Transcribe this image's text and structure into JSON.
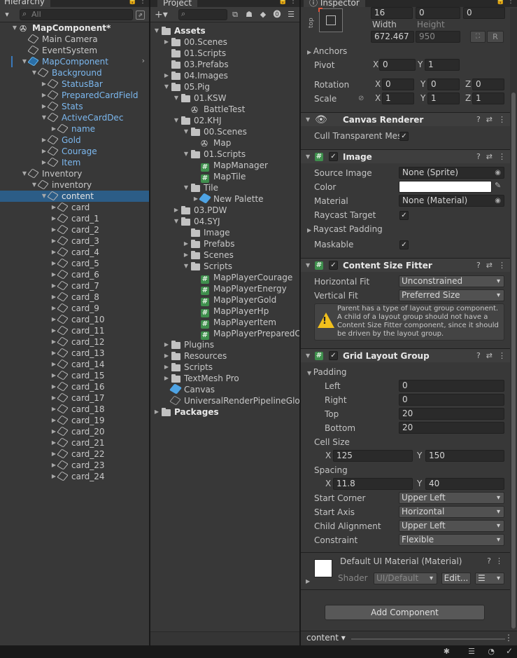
{
  "hierarchy": {
    "tab": "Hierarchy",
    "search_placeholder": "All",
    "rows": [
      {
        "label": "MapComponent*",
        "depth": 0,
        "arrow": "▼",
        "icon": "unity",
        "style": "bold"
      },
      {
        "label": "Main Camera",
        "depth": 1,
        "arrow": "",
        "icon": "go",
        "style": ""
      },
      {
        "label": "EventSystem",
        "depth": 1,
        "arrow": "",
        "icon": "go",
        "style": ""
      },
      {
        "label": "MapComponent",
        "depth": 1,
        "arrow": "▼",
        "icon": "goblue",
        "style": "blue"
      },
      {
        "label": "Background",
        "depth": 2,
        "arrow": "▼",
        "icon": "go",
        "style": "blue"
      },
      {
        "label": "StatusBar",
        "depth": 3,
        "arrow": "▶",
        "icon": "go",
        "style": "blue"
      },
      {
        "label": "PreparedCardField",
        "depth": 3,
        "arrow": "▶",
        "icon": "go",
        "style": "blue"
      },
      {
        "label": "Stats",
        "depth": 3,
        "arrow": "▶",
        "icon": "go",
        "style": "blue"
      },
      {
        "label": "ActiveCardDec",
        "depth": 3,
        "arrow": "▼",
        "icon": "go",
        "style": "blue"
      },
      {
        "label": "name",
        "depth": 4,
        "arrow": "▶",
        "icon": "go",
        "style": "blue"
      },
      {
        "label": "Gold",
        "depth": 3,
        "arrow": "▶",
        "icon": "go",
        "style": "blue"
      },
      {
        "label": "Courage",
        "depth": 3,
        "arrow": "▶",
        "icon": "go",
        "style": "blue"
      },
      {
        "label": "Item",
        "depth": 3,
        "arrow": "▶",
        "icon": "go",
        "style": "blue"
      },
      {
        "label": "Inventory",
        "depth": 1,
        "arrow": "▼",
        "icon": "go",
        "style": ""
      },
      {
        "label": "inventory",
        "depth": 2,
        "arrow": "▼",
        "icon": "go",
        "style": ""
      },
      {
        "label": "content",
        "depth": 3,
        "arrow": "▼",
        "icon": "go",
        "style": "white",
        "selected": true
      },
      {
        "label": "card",
        "depth": 4,
        "arrow": "▶",
        "icon": "go",
        "style": ""
      },
      {
        "label": "card_1",
        "depth": 4,
        "arrow": "▶",
        "icon": "go",
        "style": ""
      },
      {
        "label": "card_2",
        "depth": 4,
        "arrow": "▶",
        "icon": "go",
        "style": ""
      },
      {
        "label": "card_3",
        "depth": 4,
        "arrow": "▶",
        "icon": "go",
        "style": ""
      },
      {
        "label": "card_4",
        "depth": 4,
        "arrow": "▶",
        "icon": "go",
        "style": ""
      },
      {
        "label": "card_5",
        "depth": 4,
        "arrow": "▶",
        "icon": "go",
        "style": ""
      },
      {
        "label": "card_6",
        "depth": 4,
        "arrow": "▶",
        "icon": "go",
        "style": ""
      },
      {
        "label": "card_7",
        "depth": 4,
        "arrow": "▶",
        "icon": "go",
        "style": ""
      },
      {
        "label": "card_8",
        "depth": 4,
        "arrow": "▶",
        "icon": "go",
        "style": ""
      },
      {
        "label": "card_9",
        "depth": 4,
        "arrow": "▶",
        "icon": "go",
        "style": ""
      },
      {
        "label": "card_10",
        "depth": 4,
        "arrow": "▶",
        "icon": "go",
        "style": ""
      },
      {
        "label": "card_11",
        "depth": 4,
        "arrow": "▶",
        "icon": "go",
        "style": ""
      },
      {
        "label": "card_12",
        "depth": 4,
        "arrow": "▶",
        "icon": "go",
        "style": ""
      },
      {
        "label": "card_13",
        "depth": 4,
        "arrow": "▶",
        "icon": "go",
        "style": ""
      },
      {
        "label": "card_14",
        "depth": 4,
        "arrow": "▶",
        "icon": "go",
        "style": ""
      },
      {
        "label": "card_15",
        "depth": 4,
        "arrow": "▶",
        "icon": "go",
        "style": ""
      },
      {
        "label": "card_16",
        "depth": 4,
        "arrow": "▶",
        "icon": "go",
        "style": ""
      },
      {
        "label": "card_17",
        "depth": 4,
        "arrow": "▶",
        "icon": "go",
        "style": ""
      },
      {
        "label": "card_18",
        "depth": 4,
        "arrow": "▶",
        "icon": "go",
        "style": ""
      },
      {
        "label": "card_19",
        "depth": 4,
        "arrow": "▶",
        "icon": "go",
        "style": ""
      },
      {
        "label": "card_20",
        "depth": 4,
        "arrow": "▶",
        "icon": "go",
        "style": ""
      },
      {
        "label": "card_21",
        "depth": 4,
        "arrow": "▶",
        "icon": "go",
        "style": ""
      },
      {
        "label": "card_22",
        "depth": 4,
        "arrow": "▶",
        "icon": "go",
        "style": ""
      },
      {
        "label": "card_23",
        "depth": 4,
        "arrow": "▶",
        "icon": "go",
        "style": ""
      },
      {
        "label": "card_24",
        "depth": 4,
        "arrow": "▶",
        "icon": "go",
        "style": ""
      }
    ]
  },
  "project": {
    "tab": "Project",
    "rows": [
      {
        "label": "Assets",
        "depth": 0,
        "arrow": "▼",
        "icon": "folder",
        "style": "bold"
      },
      {
        "label": "00.Scenes",
        "depth": 1,
        "arrow": "▶",
        "icon": "folder",
        "style": ""
      },
      {
        "label": "01.Scripts",
        "depth": 1,
        "arrow": "",
        "icon": "folder",
        "style": ""
      },
      {
        "label": "03.Prefabs",
        "depth": 1,
        "arrow": "",
        "icon": "folder",
        "style": ""
      },
      {
        "label": "04.Images",
        "depth": 1,
        "arrow": "▶",
        "icon": "folder",
        "style": ""
      },
      {
        "label": "05.Pig",
        "depth": 1,
        "arrow": "▼",
        "icon": "folder",
        "style": ""
      },
      {
        "label": "01.KSW",
        "depth": 2,
        "arrow": "▼",
        "icon": "folder",
        "style": ""
      },
      {
        "label": "BattleTest",
        "depth": 3,
        "arrow": "",
        "icon": "scene",
        "style": ""
      },
      {
        "label": "02.KHJ",
        "depth": 2,
        "arrow": "▼",
        "icon": "folder",
        "style": ""
      },
      {
        "label": "00.Scenes",
        "depth": 3,
        "arrow": "▼",
        "icon": "folder",
        "style": ""
      },
      {
        "label": "Map",
        "depth": 4,
        "arrow": "",
        "icon": "scene",
        "style": ""
      },
      {
        "label": "01.Scripts",
        "depth": 3,
        "arrow": "▼",
        "icon": "folder",
        "style": ""
      },
      {
        "label": "MapManager",
        "depth": 4,
        "arrow": "",
        "icon": "hash",
        "style": ""
      },
      {
        "label": "MapTile",
        "depth": 4,
        "arrow": "",
        "icon": "hash",
        "style": ""
      },
      {
        "label": "Tile",
        "depth": 3,
        "arrow": "▼",
        "icon": "folder",
        "style": ""
      },
      {
        "label": "New Palette",
        "depth": 4,
        "arrow": "▶",
        "icon": "prefab",
        "style": ""
      },
      {
        "label": "03.PDW",
        "depth": 2,
        "arrow": "▶",
        "icon": "folder",
        "style": ""
      },
      {
        "label": "04.SYJ",
        "depth": 2,
        "arrow": "▼",
        "icon": "folder",
        "style": ""
      },
      {
        "label": "Image",
        "depth": 3,
        "arrow": "",
        "icon": "folder",
        "style": ""
      },
      {
        "label": "Prefabs",
        "depth": 3,
        "arrow": "▶",
        "icon": "folder",
        "style": ""
      },
      {
        "label": "Scenes",
        "depth": 3,
        "arrow": "▶",
        "icon": "folder",
        "style": ""
      },
      {
        "label": "Scripts",
        "depth": 3,
        "arrow": "▼",
        "icon": "folder",
        "style": ""
      },
      {
        "label": "MapPlayerCourage",
        "depth": 4,
        "arrow": "",
        "icon": "hash",
        "style": ""
      },
      {
        "label": "MapPlayerEnergy",
        "depth": 4,
        "arrow": "",
        "icon": "hash",
        "style": ""
      },
      {
        "label": "MapPlayerGold",
        "depth": 4,
        "arrow": "",
        "icon": "hash",
        "style": ""
      },
      {
        "label": "MapPlayerHp",
        "depth": 4,
        "arrow": "",
        "icon": "hash",
        "style": ""
      },
      {
        "label": "MapPlayerItem",
        "depth": 4,
        "arrow": "",
        "icon": "hash",
        "style": ""
      },
      {
        "label": "MapPlayerPreparedC",
        "depth": 4,
        "arrow": "",
        "icon": "hash",
        "style": ""
      },
      {
        "label": "Plugins",
        "depth": 1,
        "arrow": "▶",
        "icon": "folder",
        "style": ""
      },
      {
        "label": "Resources",
        "depth": 1,
        "arrow": "▶",
        "icon": "folder",
        "style": ""
      },
      {
        "label": "Scripts",
        "depth": 1,
        "arrow": "▶",
        "icon": "folder",
        "style": ""
      },
      {
        "label": "TextMesh Pro",
        "depth": 1,
        "arrow": "▶",
        "icon": "folder",
        "style": ""
      },
      {
        "label": "Canvas",
        "depth": 1,
        "arrow": "",
        "icon": "prefab",
        "style": ""
      },
      {
        "label": "UniversalRenderPipelineGlob",
        "depth": 1,
        "arrow": "",
        "icon": "asset",
        "style": ""
      },
      {
        "label": "Packages",
        "depth": 0,
        "arrow": "▶",
        "icon": "folder",
        "style": "bold"
      }
    ]
  },
  "inspector": {
    "tab": "Inspector",
    "rect": {
      "anchor_label": "top",
      "pos_x": "16",
      "pos_y": "0",
      "pos_z": "0",
      "width_label": "Width",
      "height_label": "Height",
      "width": "672.467",
      "height": "950",
      "r_btn": "R"
    },
    "anchors_label": "Anchors",
    "pivot": {
      "label": "Pivot",
      "x": "0",
      "y": "1"
    },
    "rotation": {
      "label": "Rotation",
      "x": "0",
      "y": "0",
      "z": "0"
    },
    "scale": {
      "label": "Scale",
      "x": "1",
      "y": "1",
      "z": "1"
    },
    "canvas_renderer": {
      "title": "Canvas Renderer",
      "cull_label": "Cull Transparent Mes"
    },
    "image": {
      "title": "Image",
      "source_label": "Source Image",
      "source": "None (Sprite)",
      "color_label": "Color",
      "material_label": "Material",
      "material": "None (Material)",
      "raycast_target": "Raycast Target",
      "raycast_padding": "Raycast Padding",
      "maskable": "Maskable"
    },
    "csf": {
      "title": "Content Size Fitter",
      "hfit_label": "Horizontal Fit",
      "hfit": "Unconstrained",
      "vfit_label": "Vertical Fit",
      "vfit": "Preferred Size",
      "warning": "Parent has a type of layout group component. A child of a layout group should not have a Content Size Fitter component, since it should be driven by the layout group."
    },
    "grid": {
      "title": "Grid Layout Group",
      "padding": "Padding",
      "left_label": "Left",
      "left": "0",
      "right_label": "Right",
      "right": "0",
      "top_label": "Top",
      "top": "20",
      "bottom_label": "Bottom",
      "bottom": "20",
      "cell_label": "Cell Size",
      "cell_x": "125",
      "cell_y": "150",
      "spacing_label": "Spacing",
      "spacing_x": "11.8",
      "spacing_y": "40",
      "start_corner_label": "Start Corner",
      "start_corner": "Upper Left",
      "start_axis_label": "Start Axis",
      "start_axis": "Horizontal",
      "child_align_label": "Child Alignment",
      "child_align": "Upper Left",
      "constraint_label": "Constraint",
      "constraint": "Flexible"
    },
    "material": {
      "title": "Default UI Material (Material)",
      "shader_label": "Shader",
      "shader": "UI/Default",
      "edit": "Edit..."
    },
    "add_component": "Add Component",
    "footer_label": "content"
  },
  "axis": {
    "x": "X",
    "y": "Y",
    "z": "Z"
  }
}
